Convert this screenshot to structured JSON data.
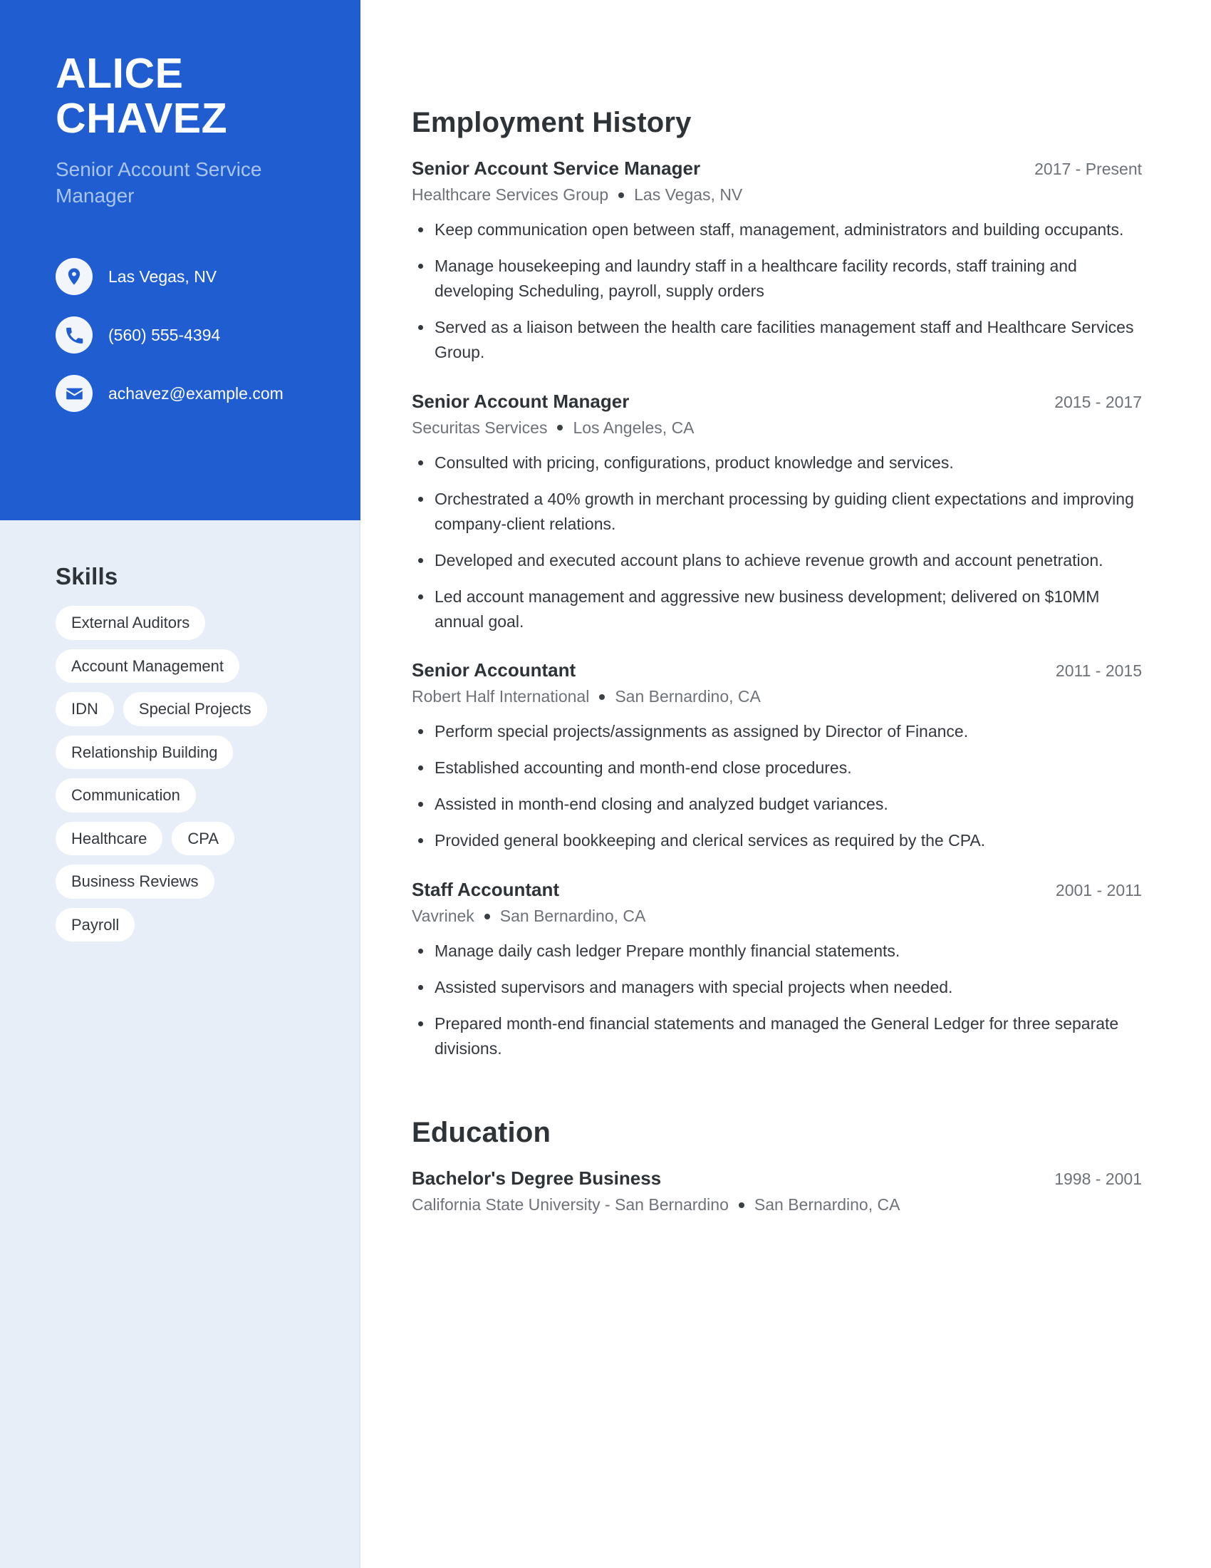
{
  "theme": {
    "accent": "#1f5dd0",
    "sidebar_bg": "#e8eef8",
    "subtitle_color": "#a9c5ea",
    "text_color": "#33383e",
    "muted_color": "#6d7278"
  },
  "header": {
    "first_name": "ALICE",
    "last_name": "CHAVEZ",
    "job_title": "Senior Account Service Manager"
  },
  "contact": {
    "items": [
      {
        "icon": "location-pin-icon",
        "value": "Las Vegas, NV"
      },
      {
        "icon": "phone-icon",
        "value": "(560) 555-4394"
      },
      {
        "icon": "email-icon",
        "value": "achavez@example.com"
      }
    ]
  },
  "skills": {
    "title": "Skills",
    "items": [
      "External Auditors",
      "Account Management",
      "IDN",
      "Special Projects",
      "Relationship Building",
      "Communication",
      "Healthcare",
      "CPA",
      "Business Reviews",
      "Payroll"
    ]
  },
  "employment": {
    "title": "Employment History",
    "entries": [
      {
        "title": "Senior Account Service Manager",
        "dates": "2017 - Present",
        "company": "Healthcare Services Group",
        "location": "Las Vegas, NV",
        "bullets": [
          "Keep communication open between staff, management, administrators and building occupants.",
          "Manage housekeeping and laundry staff in a healthcare facility records, staff training and developing Scheduling, payroll, supply orders",
          "Served as a liaison between the health care facilities management staff and Healthcare Services Group."
        ]
      },
      {
        "title": "Senior Account Manager",
        "dates": "2015 - 2017",
        "company": "Securitas Services",
        "location": "Los Angeles, CA",
        "bullets": [
          "Consulted with pricing, configurations, product knowledge and services.",
          "Orchestrated a 40% growth in merchant processing by guiding client expectations and improving company-client relations.",
          "Developed and executed account plans to achieve revenue growth and account penetration.",
          "Led account management and aggressive new business development; delivered on $10MM annual goal."
        ]
      },
      {
        "title": "Senior Accountant",
        "dates": "2011 - 2015",
        "company": "Robert Half International",
        "location": "San Bernardino, CA",
        "bullets": [
          "Perform special projects/assignments as assigned by Director of Finance.",
          "Established accounting and month-end close procedures.",
          "Assisted in month-end closing and analyzed budget variances.",
          "Provided general bookkeeping and clerical services as required by the CPA."
        ]
      },
      {
        "title": "Staff Accountant",
        "dates": "2001 - 2011",
        "company": "Vavrinek",
        "location": "San Bernardino, CA",
        "bullets": [
          "Manage daily cash ledger Prepare monthly financial statements.",
          "Assisted supervisors and managers with special projects when needed.",
          "Prepared month-end financial statements and managed the General Ledger for three separate divisions."
        ]
      }
    ]
  },
  "education": {
    "title": "Education",
    "entries": [
      {
        "title": "Bachelor's Degree Business",
        "dates": "1998 - 2001",
        "school": "California State University - San Bernardino",
        "location": "San Bernardino, CA"
      }
    ]
  }
}
